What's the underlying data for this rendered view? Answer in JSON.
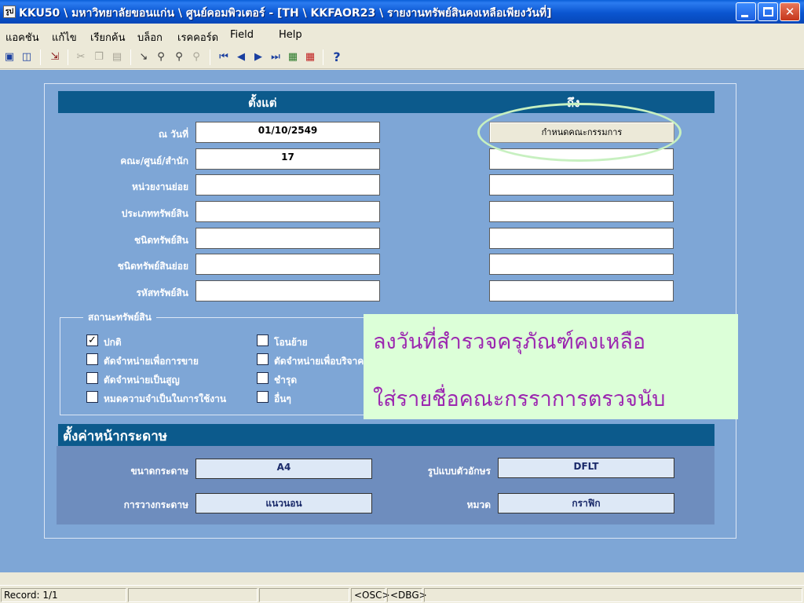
{
  "window": {
    "icon_text": "รูป",
    "title": "KKU50 \\ มหาวิทยาลัยขอนแก่น \\ ศูนย์คอมพิวเตอร์ - [TH \\ KKFAOR23 \\ รายงานทรัพย์สินคงเหลือเพียงวันที่]",
    "min_label": "",
    "close_label": "✕"
  },
  "menu": [
    "แอคชัน",
    "แก้ไข",
    "เรียกค้น",
    "บล็อก",
    "เรคคอร์ด",
    "Field",
    "Help"
  ],
  "toolbar": {
    "icons": [
      "save-icon",
      "print-preview-icon",
      "exit-icon",
      "cut-icon",
      "copy-icon",
      "paste-icon",
      "enter-query-icon",
      "execute-query-icon",
      "count-query-icon",
      "cancel-query-icon",
      "first-record-icon",
      "previous-record-icon",
      "next-record-icon",
      "last-record-icon",
      "insert-record-icon",
      "delete-record-icon",
      "help-icon"
    ],
    "help_label": "?"
  },
  "form": {
    "header_from": "ตั้งแต่",
    "header_to": "ถึง",
    "fields": [
      {
        "label": "ณ วันที่",
        "from": "01/10/2549",
        "to": ""
      },
      {
        "label": "คณะ/ศูนย์/สำนัก",
        "from": "17",
        "to": ""
      },
      {
        "label": "หน่วยงานย่อย",
        "from": "",
        "to": ""
      },
      {
        "label": "ประเภททรัพย์สิน",
        "from": "",
        "to": ""
      },
      {
        "label": "ชนิดทรัพย์สิน",
        "from": "",
        "to": ""
      },
      {
        "label": "ชนิดทรัพย์สินย่อย",
        "from": "",
        "to": ""
      },
      {
        "label": "รหัสทรัพย์สิน",
        "from": "",
        "to": ""
      }
    ],
    "committee_button": "กำหนดคณะกรรมการ",
    "status_group": {
      "title": "สถานะทรัพย์สิน",
      "items": [
        {
          "label": "ปกติ",
          "checked": true
        },
        {
          "label": "ตัดจำหน่ายเพื่อการขาย",
          "checked": false
        },
        {
          "label": "ตัดจำหน่ายเป็นสูญ",
          "checked": false
        },
        {
          "label": "หมดความจำเป็นในการใช้งาน",
          "checked": false
        },
        {
          "label": "โอนย้าย",
          "checked": false
        },
        {
          "label": "ตัดจำหน่ายเพื่อบริจาค",
          "checked": false
        },
        {
          "label": "ชำรุด",
          "checked": false
        },
        {
          "label": "อื่นๆ",
          "checked": false
        }
      ],
      "check_mark": "✓"
    },
    "annotation": {
      "line1": "ลงวันที่สำรวจครุภัณฑ์คงเหลือ",
      "line2": "ใส่รายชื่อคณะกรราการตรวจนับ"
    }
  },
  "page_setup": {
    "header": "ตั้งค่าหน้ากระดาษ",
    "paper_size_label": "ขนาดกระดาษ",
    "paper_size": "A4",
    "orientation_label": "การวางกระดาษ",
    "orientation": "แนวนอน",
    "font_label": "รูปแบบตัวอักษร",
    "font": "DFLT",
    "category_label": "หมวด",
    "category": "กราฟิก"
  },
  "statusbar": {
    "record": "Record: 1/1",
    "osc": "<OSC>",
    "dbg": "<DBG>"
  },
  "colors": {
    "background": "#7ea6d6",
    "header": "#0c5a8c",
    "annotation_bg": "#dcffd8",
    "annotation_text": "#9c27b0"
  }
}
